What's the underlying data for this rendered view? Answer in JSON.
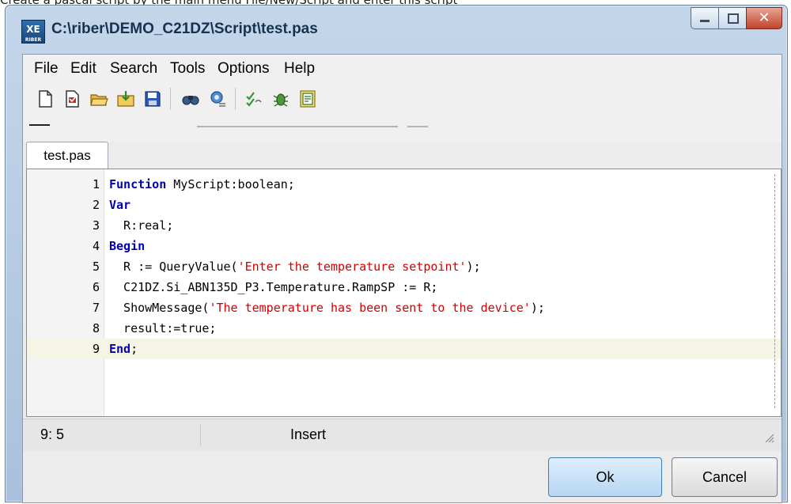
{
  "caption": "Create a pascal script by the main menu File/New/Script and enter this script",
  "window": {
    "title": "C:\\riber\\DEMO_C21DZ\\Script\\test.pas",
    "icon_label": "XE",
    "icon_sublabel": "RIBER"
  },
  "menu": {
    "items": [
      "File",
      "Edit",
      "Search",
      "Tools",
      "Options",
      "Help"
    ]
  },
  "toolbar": {
    "icons": [
      "new-file-icon",
      "open-recent-icon",
      "open-folder-icon",
      "import-icon",
      "save-icon",
      "find-icon",
      "settings-icon",
      "compile-icon",
      "debug-icon",
      "function-list-icon"
    ]
  },
  "tab": {
    "label": "test.pas"
  },
  "editor": {
    "current_line": 9,
    "lines": [
      {
        "no": "1",
        "tokens": [
          {
            "t": "kw",
            "s": "Function"
          },
          {
            "t": "plain",
            "s": " MyScript:boolean;"
          }
        ]
      },
      {
        "no": "2",
        "tokens": [
          {
            "t": "kw",
            "s": "Var"
          }
        ]
      },
      {
        "no": "3",
        "tokens": [
          {
            "t": "plain",
            "s": "  R:real;"
          }
        ]
      },
      {
        "no": "4",
        "tokens": [
          {
            "t": "kw",
            "s": "Begin"
          }
        ]
      },
      {
        "no": "5",
        "tokens": [
          {
            "t": "plain",
            "s": "  R := QueryValue("
          },
          {
            "t": "str",
            "s": "'Enter the temperature setpoint'"
          },
          {
            "t": "plain",
            "s": ");"
          }
        ]
      },
      {
        "no": "6",
        "tokens": [
          {
            "t": "plain",
            "s": "  C21DZ.Si_ABN135D_P3.Temperature.RampSP := R;"
          }
        ]
      },
      {
        "no": "7",
        "tokens": [
          {
            "t": "plain",
            "s": "  ShowMessage("
          },
          {
            "t": "str",
            "s": "'The temperature has been sent to the device'"
          },
          {
            "t": "plain",
            "s": ");"
          }
        ]
      },
      {
        "no": "8",
        "tokens": [
          {
            "t": "plain",
            "s": "  result:=true;"
          }
        ]
      },
      {
        "no": "9",
        "tokens": [
          {
            "t": "kw",
            "s": "End"
          },
          {
            "t": "plain",
            "s": ";"
          }
        ]
      }
    ]
  },
  "status": {
    "position": "9: 5",
    "mode": "Insert"
  },
  "buttons": {
    "ok": "Ok",
    "cancel": "Cancel"
  },
  "colors": {
    "keyword": "#0000b0",
    "string": "#d40000",
    "current_line": "#f6f4e4"
  }
}
